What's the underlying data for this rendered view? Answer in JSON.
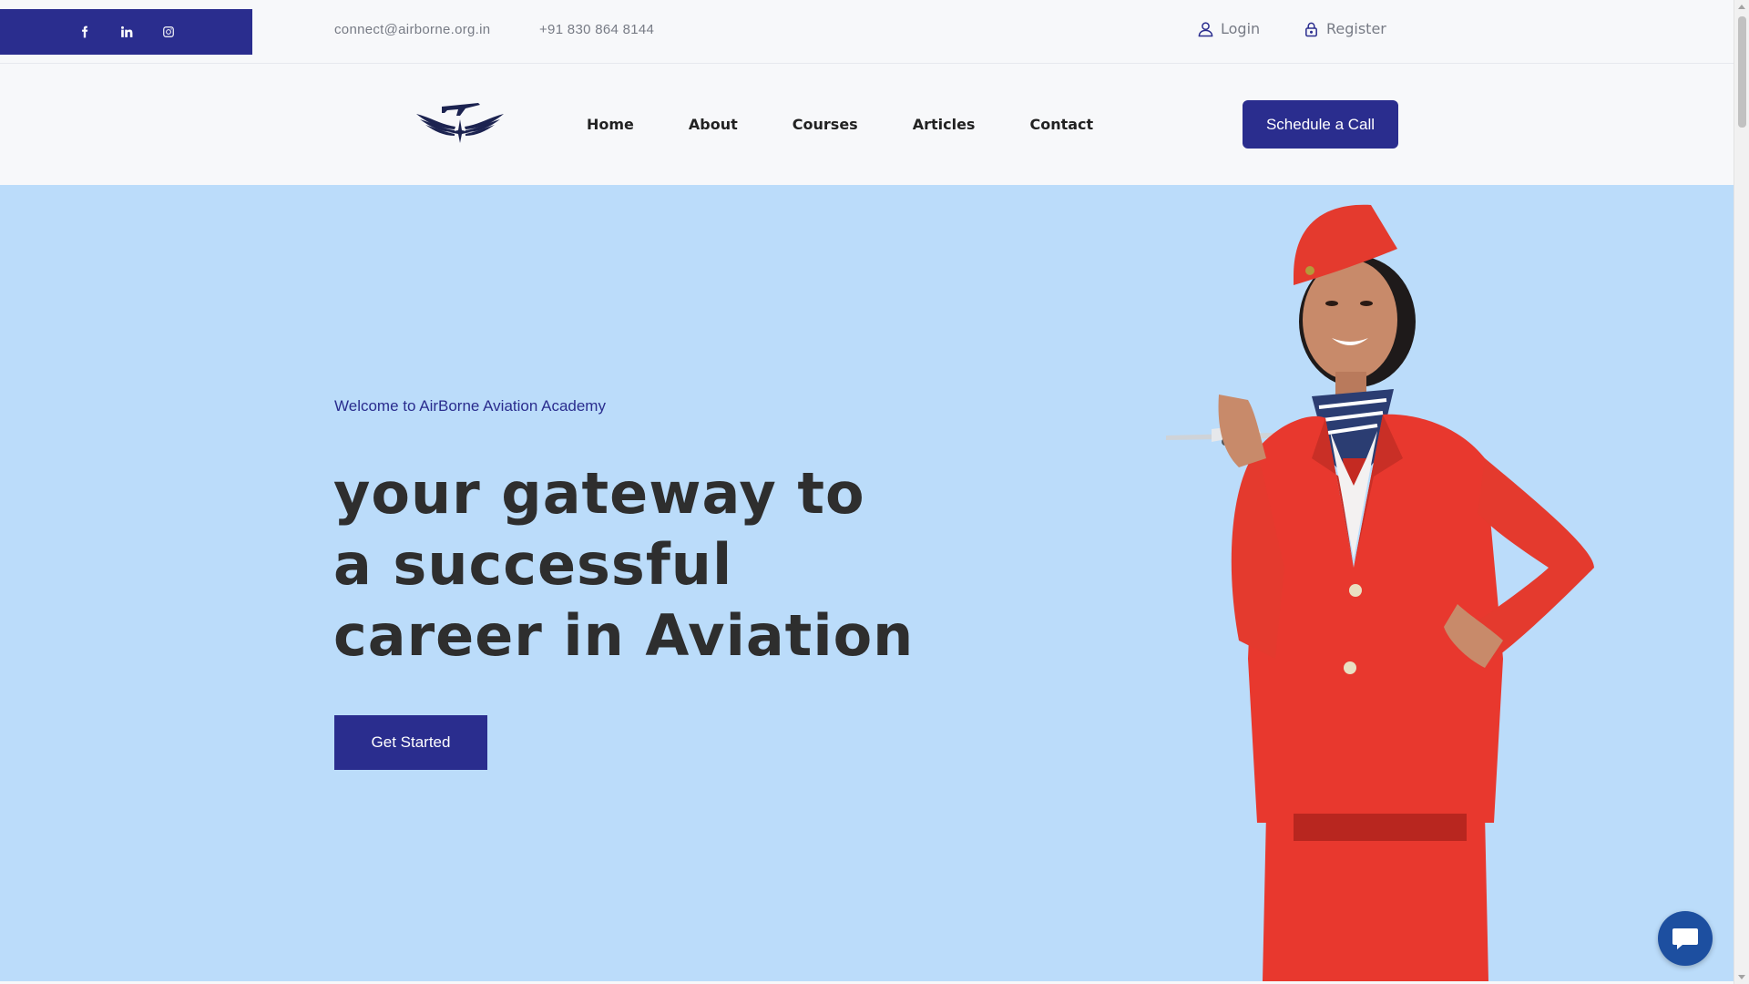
{
  "topbar": {
    "social_icons": [
      "facebook-icon",
      "linkedin-icon",
      "instagram-icon"
    ],
    "email": "connect@airborne.org.in",
    "phone": "+91 830 864 8144",
    "login_label": "Login",
    "register_label": "Register"
  },
  "nav": {
    "items": [
      {
        "label": "Home"
      },
      {
        "label": "About"
      },
      {
        "label": "Courses"
      },
      {
        "label": "Articles"
      },
      {
        "label": "Contact"
      }
    ],
    "cta_label": "Schedule a Call"
  },
  "hero": {
    "welcome": "Welcome to AirBorne Aviation Academy",
    "headline": [
      "your gateway to",
      "a successful",
      "career in Aviation"
    ],
    "button_label": "Get Started"
  },
  "colors": {
    "brand": "#2a2d8e",
    "hero_bg": "#bbdcfa",
    "uniform_red": "#e8382e"
  }
}
